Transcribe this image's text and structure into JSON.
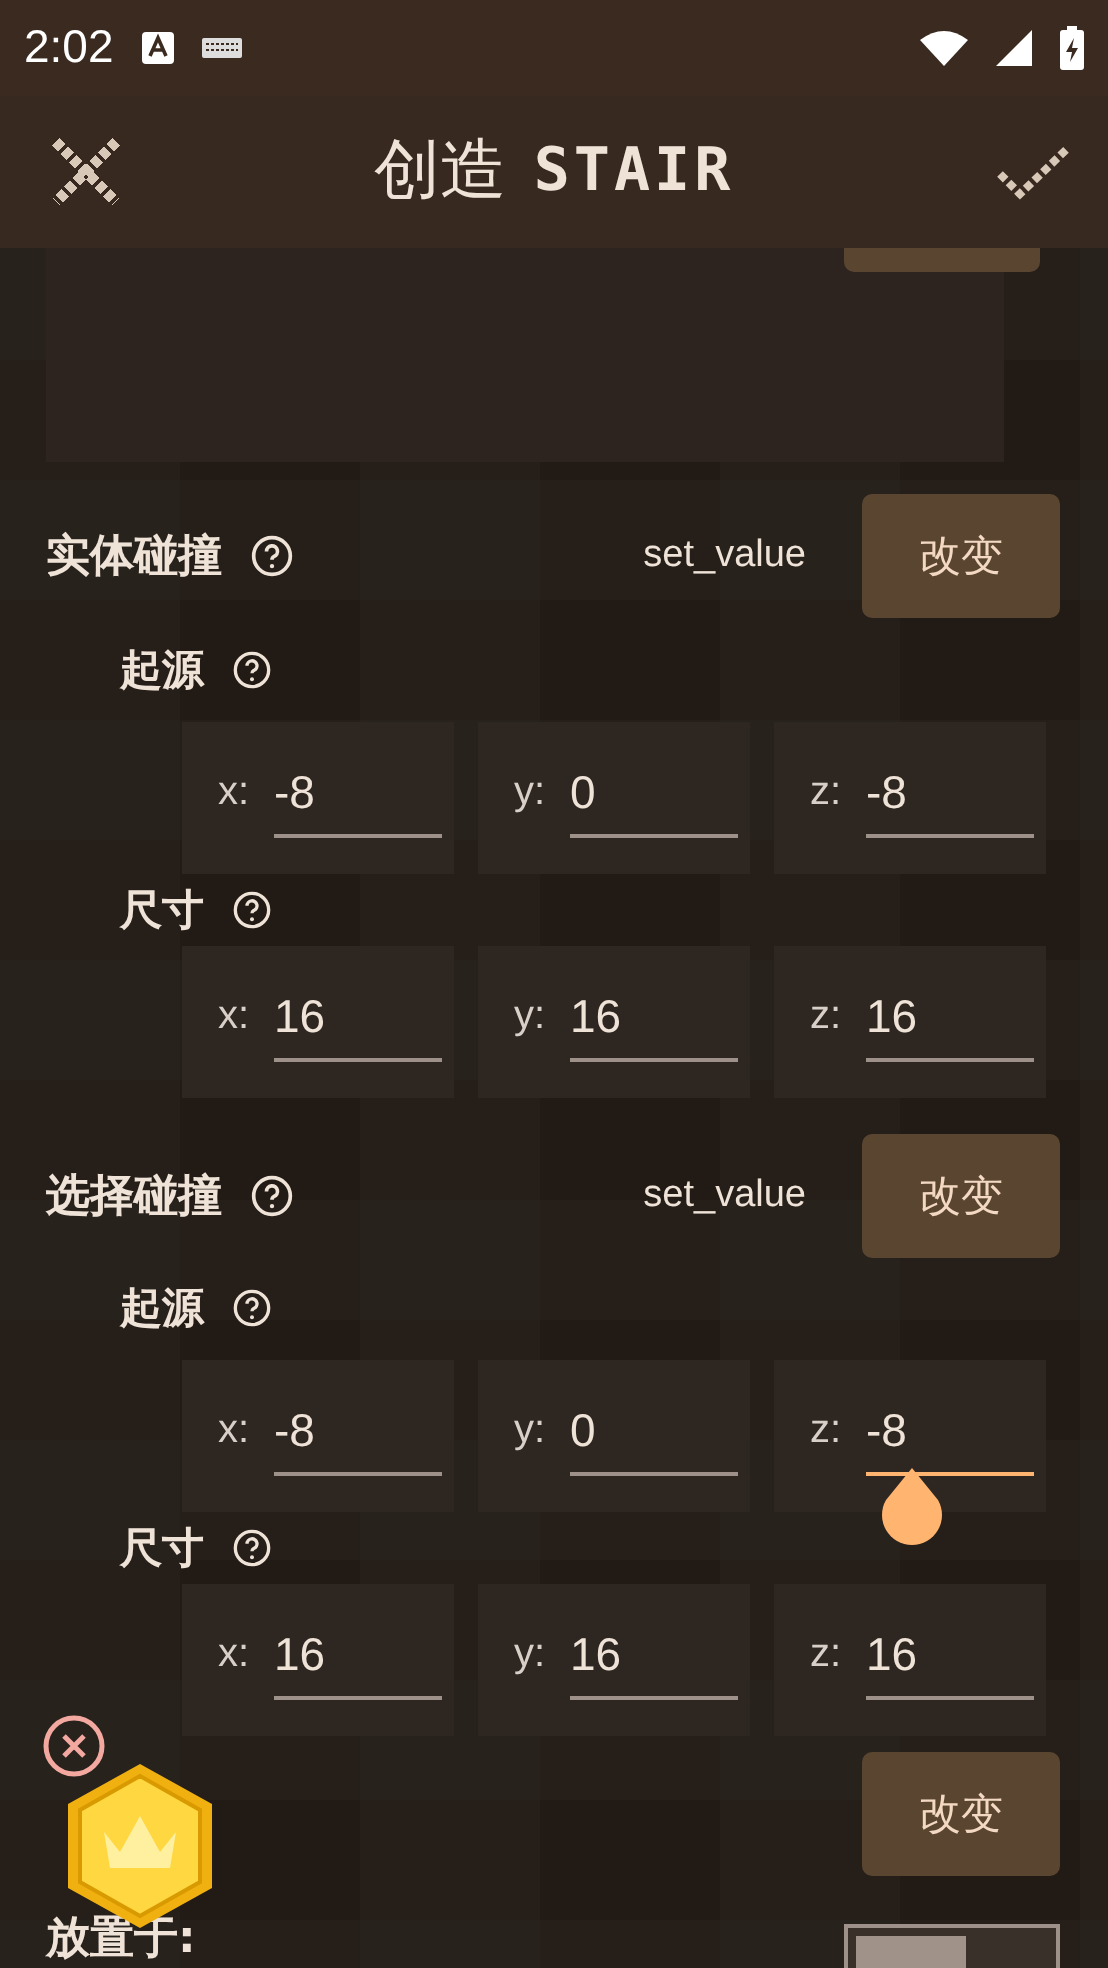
{
  "status_bar": {
    "time": "2:02"
  },
  "header": {
    "title": "创造",
    "subtitle": "STAIR"
  },
  "sections": [
    {
      "label": "实体碰撞",
      "mode": "set_value",
      "button": "改变",
      "groups": [
        {
          "label": "起源",
          "fields": [
            {
              "axis": "x:",
              "value": "-8",
              "focused": false
            },
            {
              "axis": "y:",
              "value": "0",
              "focused": false
            },
            {
              "axis": "z:",
              "value": "-8",
              "focused": false
            }
          ]
        },
        {
          "label": "尺寸",
          "fields": [
            {
              "axis": "x:",
              "value": "16",
              "focused": false
            },
            {
              "axis": "y:",
              "value": "16",
              "focused": false
            },
            {
              "axis": "z:",
              "value": "16",
              "focused": false
            }
          ]
        }
      ]
    },
    {
      "label": "选择碰撞",
      "mode": "set_value",
      "button": "改变",
      "groups": [
        {
          "label": "起源",
          "fields": [
            {
              "axis": "x:",
              "value": "-8",
              "focused": false
            },
            {
              "axis": "y:",
              "value": "0",
              "focused": false
            },
            {
              "axis": "z:",
              "value": "-8",
              "focused": true
            }
          ]
        },
        {
          "label": "尺寸",
          "fields": [
            {
              "axis": "x:",
              "value": "16",
              "focused": false
            },
            {
              "axis": "y:",
              "value": "16",
              "focused": false
            },
            {
              "axis": "z:",
              "value": "16",
              "focused": false
            }
          ]
        }
      ]
    }
  ],
  "material_row": {
    "button": "改变"
  },
  "place_row": {
    "label": "放置于:",
    "on": false
  }
}
